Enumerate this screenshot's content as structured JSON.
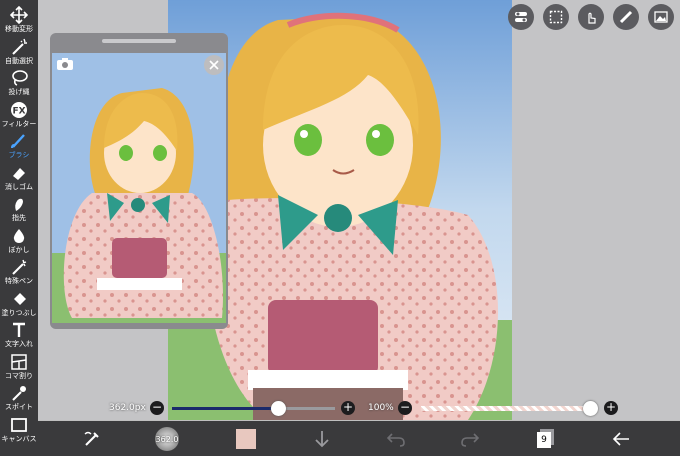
{
  "toolbar": {
    "tools": [
      {
        "label": "移動変形",
        "icon": "move-icon"
      },
      {
        "label": "自動選択",
        "icon": "magic-wand-icon"
      },
      {
        "label": "投げ縄",
        "icon": "lasso-icon"
      },
      {
        "label": "フィルター",
        "icon": "fx-icon"
      },
      {
        "label": "ブラシ",
        "icon": "brush-icon",
        "active": true
      },
      {
        "label": "消しゴム",
        "icon": "eraser-icon"
      },
      {
        "label": "指先",
        "icon": "finger-icon"
      },
      {
        "label": "ぼかし",
        "icon": "blur-drop-icon"
      },
      {
        "label": "特殊ペン",
        "icon": "special-pen-icon"
      },
      {
        "label": "塗りつぶし",
        "icon": "fill-bucket-icon"
      },
      {
        "label": "文字入れ",
        "icon": "text-icon"
      },
      {
        "label": "コマ割り",
        "icon": "frame-divider-icon"
      },
      {
        "label": "スポイト",
        "icon": "eyedropper-icon"
      },
      {
        "label": "キャンバス",
        "icon": "canvas-icon"
      }
    ]
  },
  "sliders": {
    "brush_size": "362.0px",
    "brush_size_fraction": 0.65,
    "opacity": "100%",
    "opacity_fraction": 1.0
  },
  "bottombar": {
    "brush_preview_value": "362.0",
    "layer_count": "9",
    "color": "#e8c8bf"
  },
  "colors": {
    "active_tool": "#4aa3ff",
    "toolbar_bg": "#3a3a3c",
    "size_slider": "#1b2a6b"
  }
}
